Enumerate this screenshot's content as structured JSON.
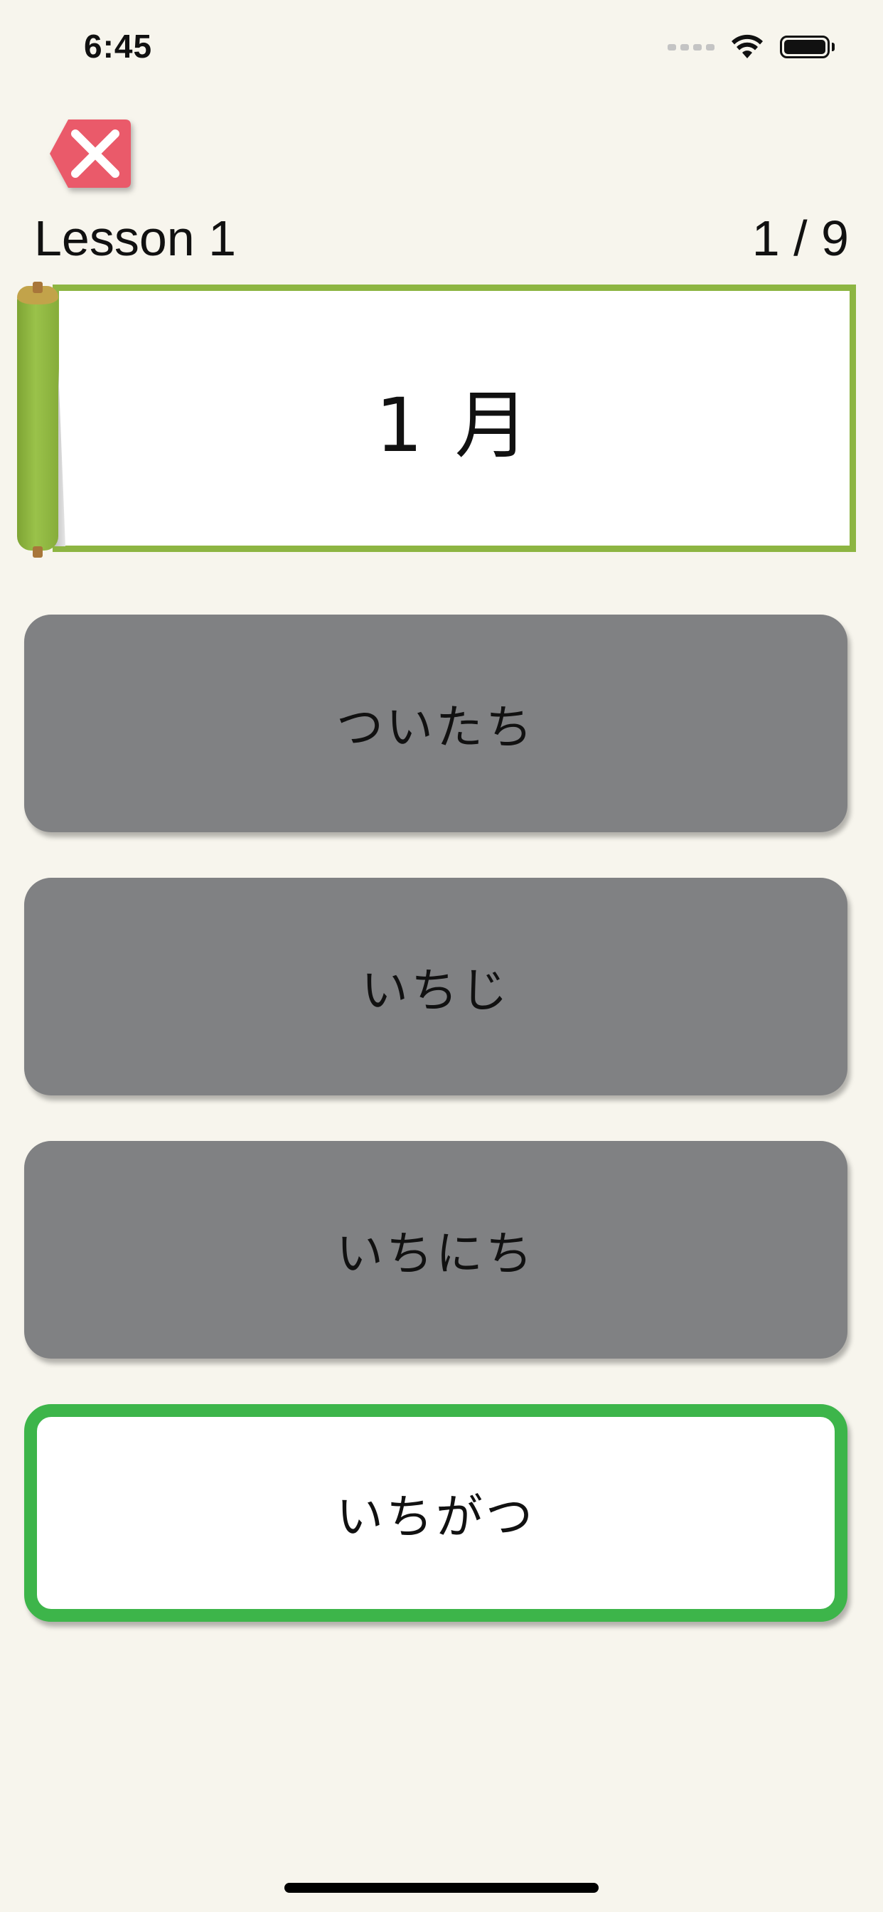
{
  "status_bar": {
    "time": "6:45",
    "icons": [
      "signal-icon",
      "wifi-icon",
      "battery-icon"
    ]
  },
  "header": {
    "close_icon": "close-icon",
    "lesson_title": "Lesson 1",
    "progress": "1 / 9"
  },
  "question": {
    "text": "1 月"
  },
  "options": [
    {
      "label": "ついたち",
      "state": "default"
    },
    {
      "label": "いちじ",
      "state": "default"
    },
    {
      "label": "いちにち",
      "state": "default"
    },
    {
      "label": "いちがつ",
      "state": "correct"
    }
  ],
  "colors": {
    "background": "#f7f5ed",
    "option_default": "#808183",
    "option_correct_border": "#3db54a",
    "scroll_green": "#8db542",
    "close_button": "#ea5a6a"
  }
}
